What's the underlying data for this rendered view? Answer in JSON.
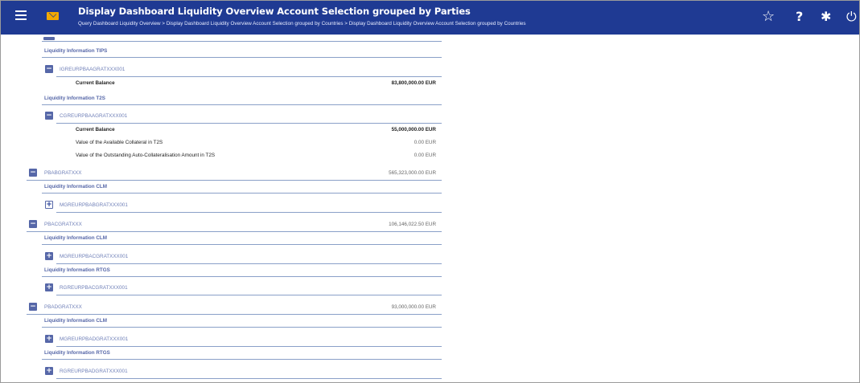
{
  "header": {
    "title": "Display Dashboard Liquidity Overview Account Selection grouped by Parties",
    "breadcrumb": "Query Dashboard Liquidity Overview > Display Dashboard Liquidity Overview Account Selection grouped by Countries > Display Dashboard Liquidity Overview Account Selection grouped by Countries",
    "icons": {
      "menu": "menu-icon",
      "mail": "mail-icon",
      "favourite": "star-icon",
      "help": "help-icon",
      "settings": "gear-icon",
      "logout": "power-icon"
    },
    "star_glyph": "☆",
    "help_glyph": "?",
    "gear_glyph": "✱",
    "power_glyph": "⏻"
  },
  "colors": {
    "header_bg": "#1f3a93",
    "accent": "#5667a8",
    "line": "#8aa0c8",
    "mail_icon": "#f2a900"
  },
  "content": {
    "tips_section": "Liquidity Information TIPS",
    "tips_account": "IGREURPBAAGRATXXX001",
    "tips_current_balance_label": "Current Balance",
    "tips_current_balance_value": "83,800,000.00 EUR",
    "t2s_section": "Liquidity Information T2S",
    "t2s_account": "CGREURPBAAGRATXXX001",
    "t2s_current_balance_label": "Current Balance",
    "t2s_current_balance_value": "55,000,000.00 EUR",
    "t2s_collateral_label": "Value of the Available Collateral in T2S",
    "t2s_collateral_value": "0.00 EUR",
    "t2s_autocoll_label": "Value of the Outstanding Auto-Collateralisation Amount in T2S",
    "t2s_autocoll_value": "0.00 EUR",
    "party_b": "PBABGRATXXX",
    "party_b_value": "565,323,000.00 EUR",
    "party_b_clm_section": "Liquidity Information CLM",
    "party_b_clm_account": "MGREURPBABGRATXXX001",
    "party_c": "PBACGRATXXX",
    "party_c_value": "106,146,022.50 EUR",
    "party_c_clm_section": "Liquidity Information CLM",
    "party_c_clm_account": "MGREURPBACGRATXXX001",
    "party_c_rtgs_section": "Liquidity Information RTGS",
    "party_c_rtgs_account": "RGREURPBACGRATXXX001",
    "party_d": "PBADGRATXXX",
    "party_d_value": "93,000,000.00 EUR",
    "party_d_clm_section": "Liquidity Information CLM",
    "party_d_clm_account": "MGREURPBADGRATXXX001",
    "party_d_rtgs_section": "Liquidity Information RTGS",
    "party_d_rtgs_account": "RGREURPBADGRATXXX001",
    "minus_glyph": "−",
    "plus_glyph": "+"
  }
}
